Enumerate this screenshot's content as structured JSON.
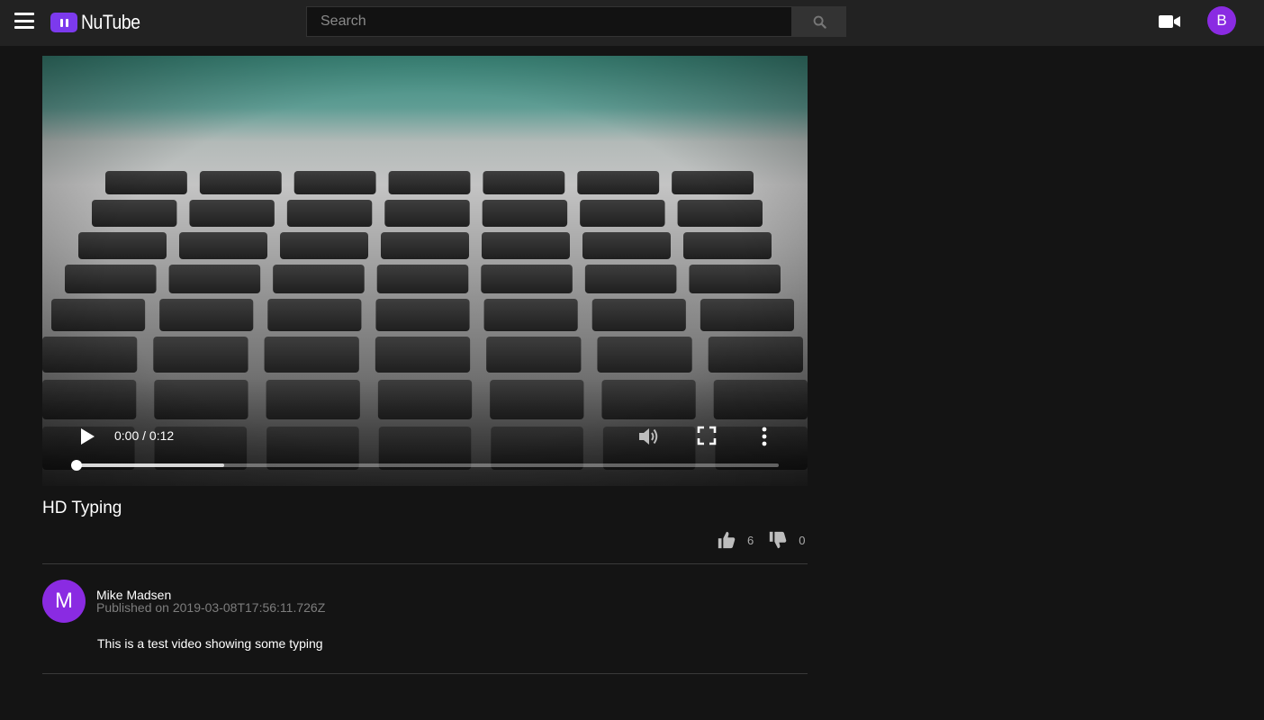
{
  "app": {
    "name": "NuTube",
    "user_initial": "B"
  },
  "search": {
    "placeholder": "Search"
  },
  "icons": {
    "menu": "hamburger-icon",
    "search": "magnifier-icon",
    "upload": "video-camera-icon",
    "play": "play-icon",
    "volume": "volume-icon",
    "fullscreen": "fullscreen-icon",
    "more": "vertical-dots-icon",
    "like": "thumbs-up-icon",
    "dislike": "thumbs-down-icon"
  },
  "colors": {
    "accent": "#7c3aed",
    "avatar": "#8a2be2",
    "topbar": "#222222",
    "background": "#141414"
  },
  "player": {
    "time_display": "0:00 / 0:12",
    "current_fraction": 0,
    "buffered_fraction": 0.21
  },
  "video": {
    "title": "HD Typing",
    "likes": "6",
    "dislikes": "0",
    "channel": {
      "initial": "M",
      "name": "Mike Madsen"
    },
    "published": "Published on 2019-03-08T17:56:11.726Z",
    "description": "This is a test video showing some typing"
  }
}
